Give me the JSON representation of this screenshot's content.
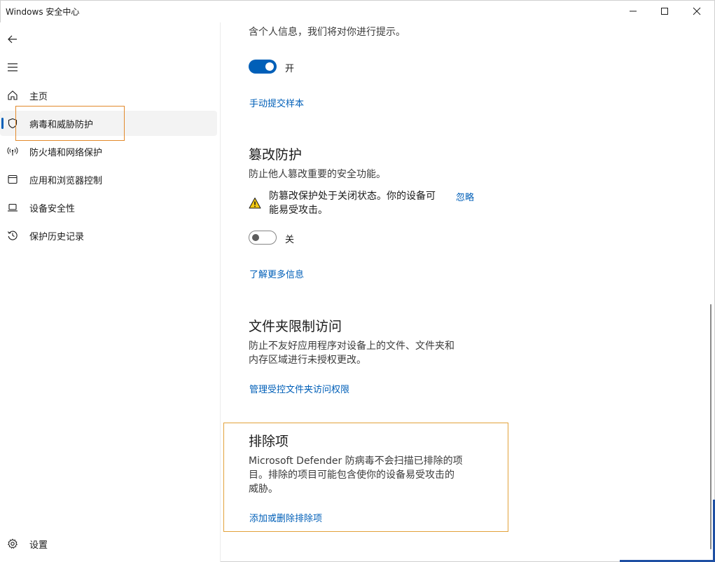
{
  "window": {
    "title": "Windows 安全中心"
  },
  "sidebar": {
    "items": [
      {
        "label": "主页",
        "icon": "home-icon"
      },
      {
        "label": "病毒和威胁防护",
        "icon": "shield-icon"
      },
      {
        "label": "防火墙和网络保护",
        "icon": "wireless-icon"
      },
      {
        "label": "应用和浏览器控制",
        "icon": "app-window-icon"
      },
      {
        "label": "设备安全性",
        "icon": "laptop-icon"
      },
      {
        "label": "保护历史记录",
        "icon": "history-icon"
      }
    ],
    "selected_index": 1,
    "settings_label": "设置"
  },
  "content": {
    "intro_tail": "含个人信息，我们将对你进行提示。",
    "sample_toggle": {
      "state_label": "开",
      "on": true
    },
    "submit_sample_link": "手动提交样本",
    "tamper": {
      "title": "篡改防护",
      "description": "防止他人篡改重要的安全功能。",
      "warning_line1": "防篡改保护处于关闭状态。你的设备可",
      "warning_line2": "能易受攻击。",
      "dismiss_label": "忽略",
      "toggle_label": "关",
      "toggle_on": false,
      "learn_more": "了解更多信息"
    },
    "folder_access": {
      "title": "文件夹限制访问",
      "description_line1": "防止不友好应用程序对设备上的文件、文件夹和",
      "description_line2": "内存区域进行未授权更改。",
      "manage_link": "管理受控文件夹访问权限"
    },
    "exclusions": {
      "title": "排除项",
      "description_line1": "Microsoft Defender 防病毒不会扫描已排除的项",
      "description_line2": "目。排除的项目可能包含使你的设备易受攻击的",
      "description_line3": "威胁。",
      "add_remove_link": "添加或删除排除项"
    }
  },
  "colors": {
    "accent": "#005fb8",
    "highlight_outline": "#e2892b",
    "warning": "#f2c811"
  }
}
